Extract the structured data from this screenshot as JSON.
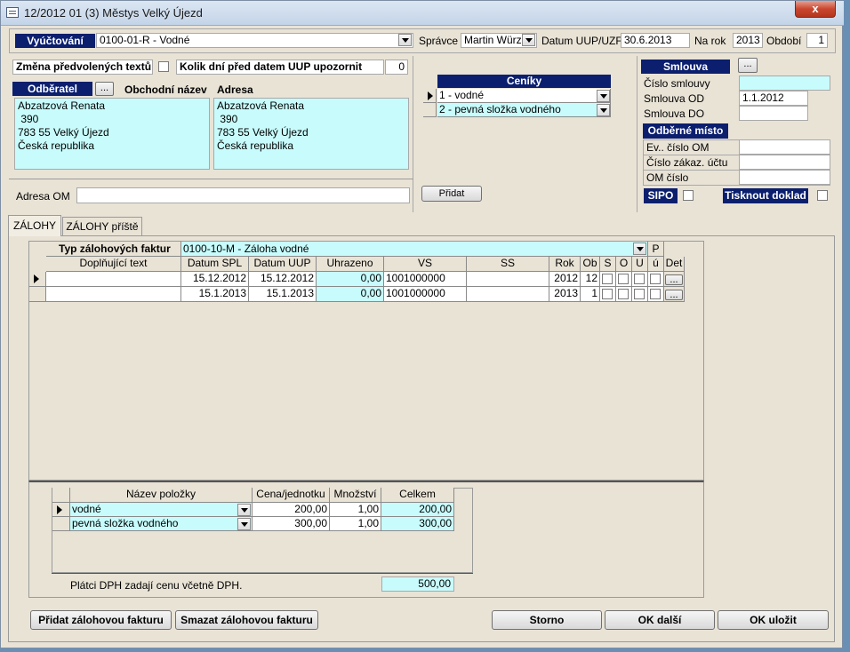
{
  "window": {
    "title": "12/2012  01  (3)  Městys Velký Újezd",
    "close_label": "x"
  },
  "header": {
    "vyuctovani_label": "Vyúčtování",
    "vyuctovani_value": "0100-01-R - Vodné",
    "spravce_label": "Správce",
    "spravce_value": "Martin Würzl",
    "datum_uup_label": "Datum UUP/UZF",
    "datum_uup_value": "30.6.2013",
    "na_rok_label": "Na rok",
    "na_rok_value": "2013",
    "obdobi_label": "Období",
    "obdobi_value": "1"
  },
  "left": {
    "zmena_label": "Změna předvolených textů",
    "kolik_label": "Kolik dní před datem UUP upozornit",
    "kolik_value": "0",
    "odberatel_label": "Odběratel",
    "odberatel_btn": "...",
    "obchodni_nazev_label": "Obchodní název",
    "adresa_label": "Adresa",
    "obchodni_lines": [
      "Abzatzová Renata",
      " 390",
      "783 55 Velký Újezd",
      "Česká republika"
    ],
    "adresa_lines": [
      "Abzatzová Renata",
      " 390",
      "783 55 Velký Újezd",
      "Česká republika"
    ],
    "adresa_om_label": "Adresa OM",
    "adresa_om_value": ""
  },
  "ceniky": {
    "title": "Ceníky",
    "rows": [
      "1 - vodné",
      "2 - pevná složka vodného"
    ],
    "pridat_label": "Přidat"
  },
  "smlouva": {
    "title": "Smlouva",
    "btn": "...",
    "cislo_label": "Číslo smlouvy",
    "cislo_value": "",
    "od_label": "Smlouva OD",
    "od_value": "1.1.2012",
    "do_label": "Smlouva DO",
    "do_value": "",
    "odberne_title": "Odběrné místo",
    "ev_cislo_label": "Ev.. číslo OM",
    "zakaz_label": "Číslo zákaz. účtu",
    "om_cislo_label": "OM číslo",
    "sipo_label": "SIPO",
    "tisknout_label": "Tisknout doklad"
  },
  "tabs": [
    "ZÁLOHY",
    "ZÁLOHY příště"
  ],
  "zalohy": {
    "typ_label": "Typ zálohových faktur",
    "typ_value": "0100-10-M - Záloha vodné",
    "p_label": "P",
    "columns": [
      "Doplňující text",
      "Datum SPL",
      "Datum UUP",
      "Uhrazeno",
      "VS",
      "SS",
      "Rok",
      "Ob",
      "S",
      "O",
      "U",
      "ú",
      "Det"
    ],
    "rows": [
      {
        "text": "",
        "datum_spl": "15.12.2012",
        "datum_uup": "15.12.2012",
        "uhrazeno": "0,00",
        "vs": "1001000000",
        "ss": "",
        "rok": "2012",
        "ob": "12",
        "det": "..."
      },
      {
        "text": "",
        "datum_spl": "15.1.2013",
        "datum_uup": "15.1.2013",
        "uhrazeno": "0,00",
        "vs": "1001000000",
        "ss": "",
        "rok": "2013",
        "ob": "1",
        "det": "..."
      }
    ]
  },
  "polozky": {
    "columns": [
      "Název položky",
      "Cena/jednotku",
      "Množství",
      "Celkem"
    ],
    "rows": [
      {
        "nazev": "vodné",
        "cena": "200,00",
        "mnozstvi": "1,00",
        "celkem": "200,00"
      },
      {
        "nazev": "pevná složka vodného",
        "cena": "300,00",
        "mnozstvi": "1,00",
        "celkem": "300,00"
      }
    ],
    "dph_note": "Plátci DPH zadají cenu včetně DPH.",
    "total": "500,00"
  },
  "buttons": {
    "pridat_zalohovou": "Přidat zálohovou fakturu",
    "smazat_zalohovou": "Smazat zálohovou fakturu",
    "storno": "Storno",
    "ok_dalsi": "OK další",
    "ok_ulozit": "OK uložit"
  }
}
